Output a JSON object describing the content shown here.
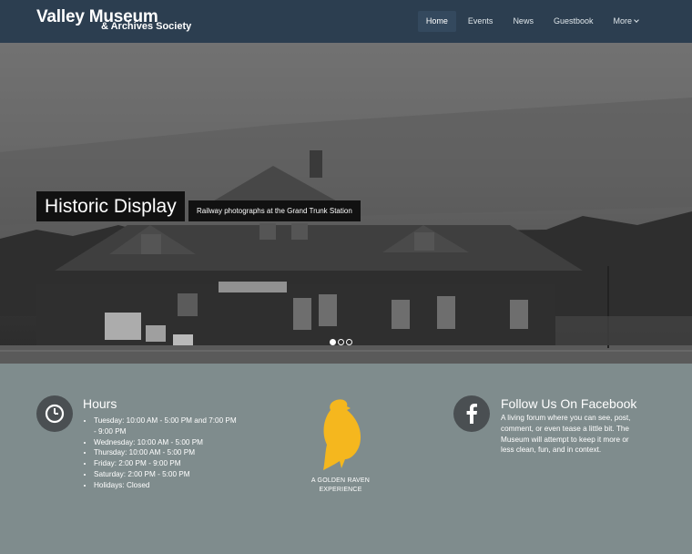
{
  "header": {
    "brand_main": "Valley Museum",
    "brand_sub": "& Archives Society",
    "nav": [
      {
        "label": "Home",
        "active": true
      },
      {
        "label": "Events"
      },
      {
        "label": "News"
      },
      {
        "label": "Guestbook"
      },
      {
        "label": "More"
      }
    ]
  },
  "hero": {
    "title": "Historic Display",
    "subtitle": "Railway photographs at the Grand Trunk Station",
    "slide_count": 3,
    "active_slide": 1
  },
  "hours": {
    "title": "Hours",
    "icon": "clock-icon",
    "items": [
      "Tuesday: 10:00 AM - 5:00 PM and 7:00 PM - 9:00 PM",
      "Wednesday: 10:00 AM - 5:00 PM",
      "Thursday: 10:00 AM - 5:00 PM",
      "Friday: 2:00 PM - 9:00 PM",
      "Saturday: 2:00 PM - 5:00 PM",
      "Holidays: Closed"
    ]
  },
  "logo": {
    "line1": "A GOLDEN RAVEN",
    "line2": "EXPERIENCE",
    "color": "#f5b71e"
  },
  "facebook": {
    "title": "Follow Us On Facebook",
    "icon": "facebook-icon",
    "text": "A living forum where you can see, post, comment, or even tease a little bit. The Museum will attempt to keep it more or less clean, fun, and in context."
  },
  "colors": {
    "header_bg": "#2c3e50",
    "body_bg": "#7f8c8d",
    "nav_active_bg": "#34495e"
  }
}
